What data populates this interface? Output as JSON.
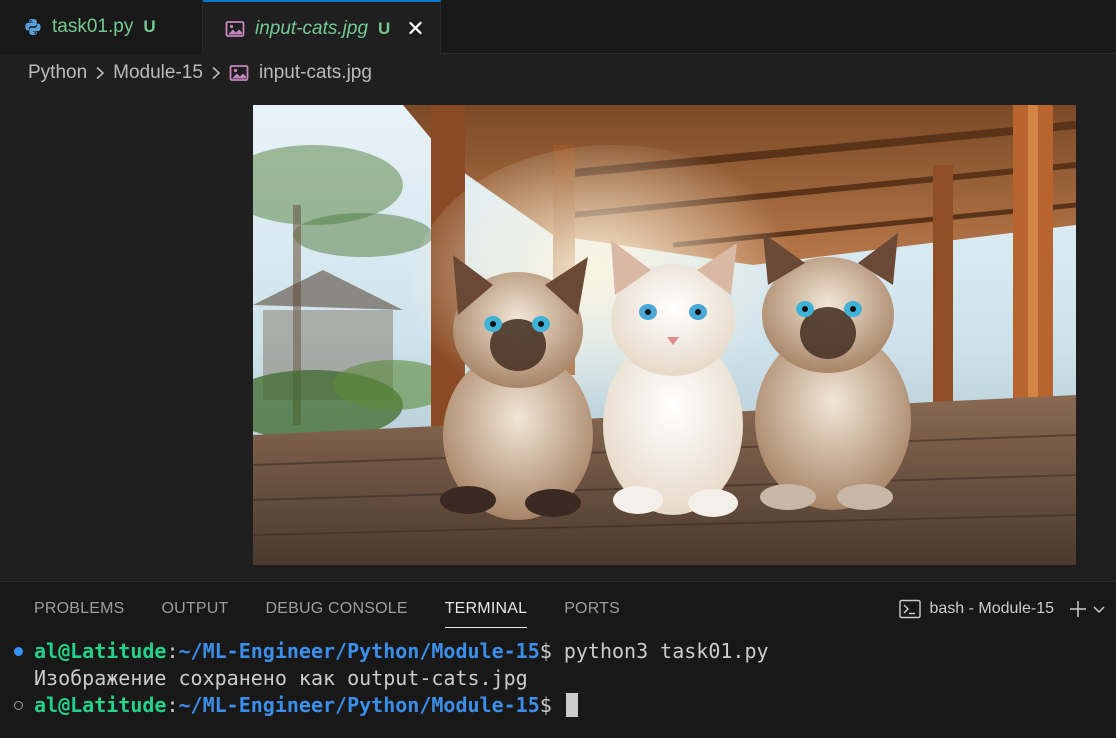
{
  "tabs": [
    {
      "label": "task01.py",
      "status": "U",
      "icon": "python-icon",
      "active": false
    },
    {
      "label": "input-cats.jpg",
      "status": "U",
      "icon": "image-file-icon",
      "active": true
    }
  ],
  "breadcrumb": [
    "Python",
    "Module-15",
    "input-cats.jpg"
  ],
  "panel": {
    "tabs": [
      "PROBLEMS",
      "OUTPUT",
      "DEBUG CONSOLE",
      "TERMINAL",
      "PORTS"
    ],
    "active_tab": "TERMINAL",
    "terminal_label": "bash - Module-15"
  },
  "terminal": {
    "lines": [
      {
        "user": "al@Latitude",
        "colon": ":",
        "path": "~/ML-Engineer/Python/Module-15",
        "prompt": "$ ",
        "cmd": "python3 task01.py"
      },
      {
        "output": "Изображение сохранено как output-cats.jpg"
      },
      {
        "user": "al@Latitude",
        "colon": ":",
        "path": "~/ML-Engineer/Python/Module-15",
        "prompt": "$ ",
        "cmd": ""
      }
    ]
  },
  "colors": {
    "accent": "#0078d4",
    "untracked": "#73c991",
    "prompt_user": "#23d18b",
    "prompt_path": "#3b8eea"
  }
}
